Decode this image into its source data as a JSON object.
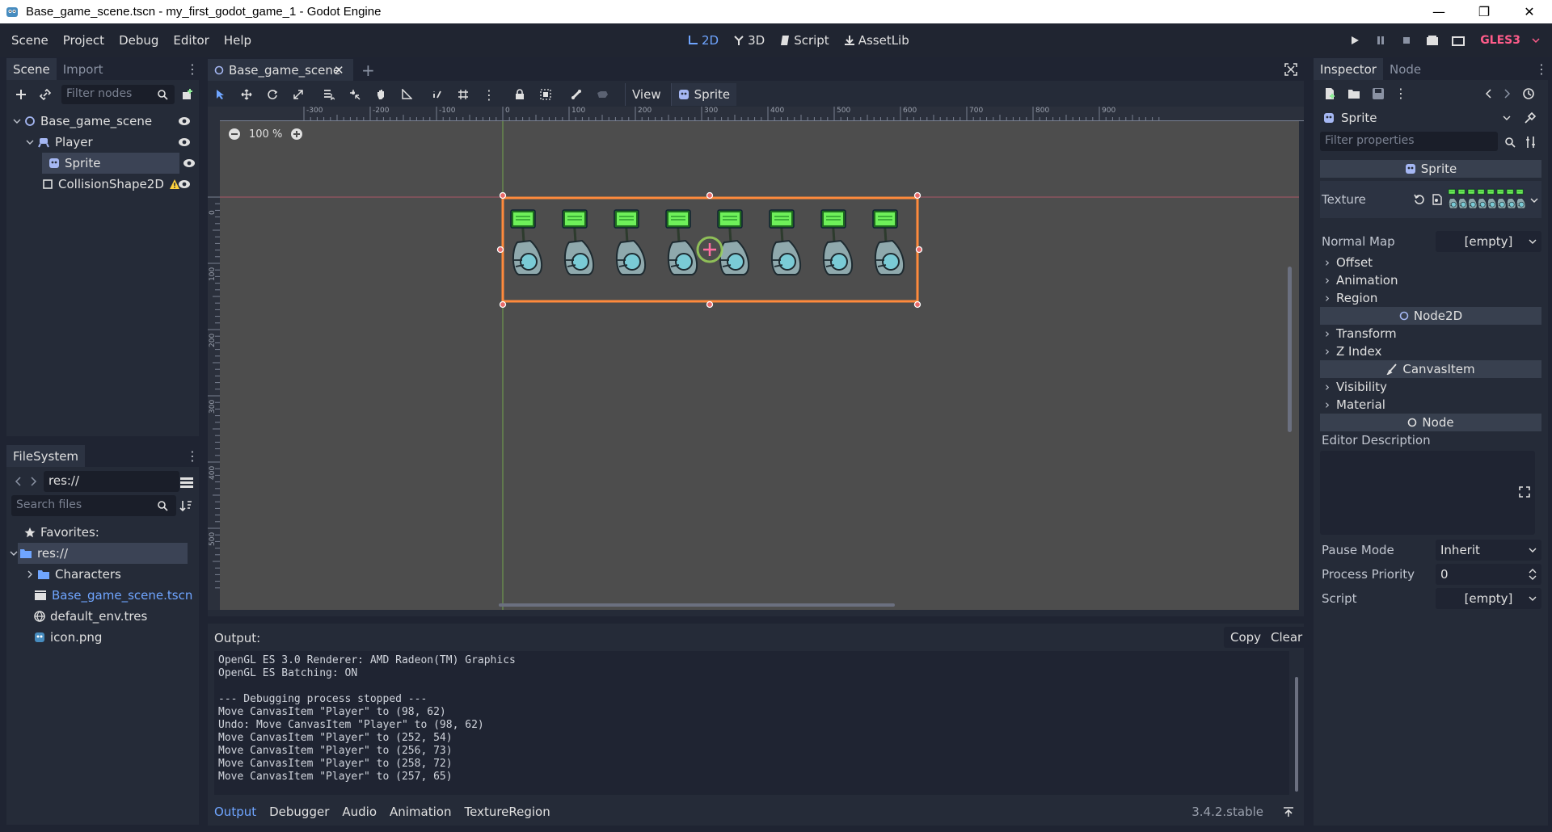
{
  "window": {
    "title": "Base_game_scene.tscn - my_first_godot_game_1 - Godot Engine",
    "minimize": "—",
    "maximize": "❐",
    "close": "✕"
  },
  "menu": [
    "Scene",
    "Project",
    "Debug",
    "Editor",
    "Help"
  ],
  "workspaces": [
    {
      "label": "2D",
      "active": true
    },
    {
      "label": "3D",
      "active": false
    },
    {
      "label": "Script",
      "active": false
    },
    {
      "label": "AssetLib",
      "active": false
    }
  ],
  "renderer": "GLES3",
  "scene_dock": {
    "tabs": [
      "Scene",
      "Import"
    ],
    "filter_placeholder": "Filter nodes",
    "nodes": [
      {
        "name": "Base_game_scene"
      },
      {
        "name": "Player"
      },
      {
        "name": "Sprite"
      },
      {
        "name": "CollisionShape2D"
      }
    ]
  },
  "filesystem": {
    "tab": "FileSystem",
    "path": "res://",
    "search_placeholder": "Search files",
    "favorites": "Favorites:",
    "items": [
      {
        "name": "res://"
      },
      {
        "name": "Characters"
      },
      {
        "name": "Base_game_scene.tscn"
      },
      {
        "name": "default_env.tres"
      },
      {
        "name": "icon.png"
      }
    ]
  },
  "editor": {
    "tab": "Base_game_scene",
    "zoom": "100 %",
    "view_menu": "View",
    "sprite_menu": "Sprite",
    "ruler_marks": [
      "-300",
      "-200",
      "-100",
      "0",
      "100",
      "200",
      "300",
      "400",
      "500",
      "600",
      "700",
      "800",
      "900"
    ],
    "ruler_left_marks": [
      "0",
      "100",
      "200",
      "300",
      "400",
      "500"
    ]
  },
  "inspector": {
    "tabs": [
      "Inspector",
      "Node"
    ],
    "object": "Sprite",
    "filter_placeholder": "Filter properties",
    "sprite_header": "Sprite",
    "texture_label": "Texture",
    "normal_map_label": "Normal Map",
    "normal_map_value": "[empty]",
    "sprite_groups": [
      "Offset",
      "Animation",
      "Region"
    ],
    "node2d_header": "Node2D",
    "node2d_groups": [
      "Transform",
      "Z Index"
    ],
    "canvasitem_header": "CanvasItem",
    "canvasitem_groups": [
      "Visibility",
      "Material"
    ],
    "node_header": "Node",
    "editor_description": "Editor Description",
    "pause_mode_label": "Pause Mode",
    "pause_mode_value": "Inherit",
    "process_priority_label": "Process Priority",
    "process_priority_value": "0",
    "script_label": "Script",
    "script_value": "[empty]"
  },
  "output": {
    "label": "Output:",
    "copy": "Copy",
    "clear": "Clear",
    "log": [
      "OpenGL ES 3.0 Renderer: AMD Radeon(TM) Graphics",
      "OpenGL ES Batching: ON",
      "",
      "--- Debugging process stopped ---",
      "Move CanvasItem \"Player\" to (98, 62)",
      "Undo: Move CanvasItem \"Player\" to (98, 62)",
      "Move CanvasItem \"Player\" to (252, 54)",
      "Move CanvasItem \"Player\" to (256, 73)",
      "Move CanvasItem \"Player\" to (258, 72)",
      "Move CanvasItem \"Player\" to (257, 65)"
    ],
    "bottom_tabs": [
      "Output",
      "Debugger",
      "Audio",
      "Animation",
      "TextureRegion"
    ],
    "version": "3.4.2.stable"
  },
  "colors": {
    "accent": "#6fa5ff",
    "gles": "#ff5c8a",
    "selection": "#ff8a3c",
    "warning": "#ffd23c"
  }
}
